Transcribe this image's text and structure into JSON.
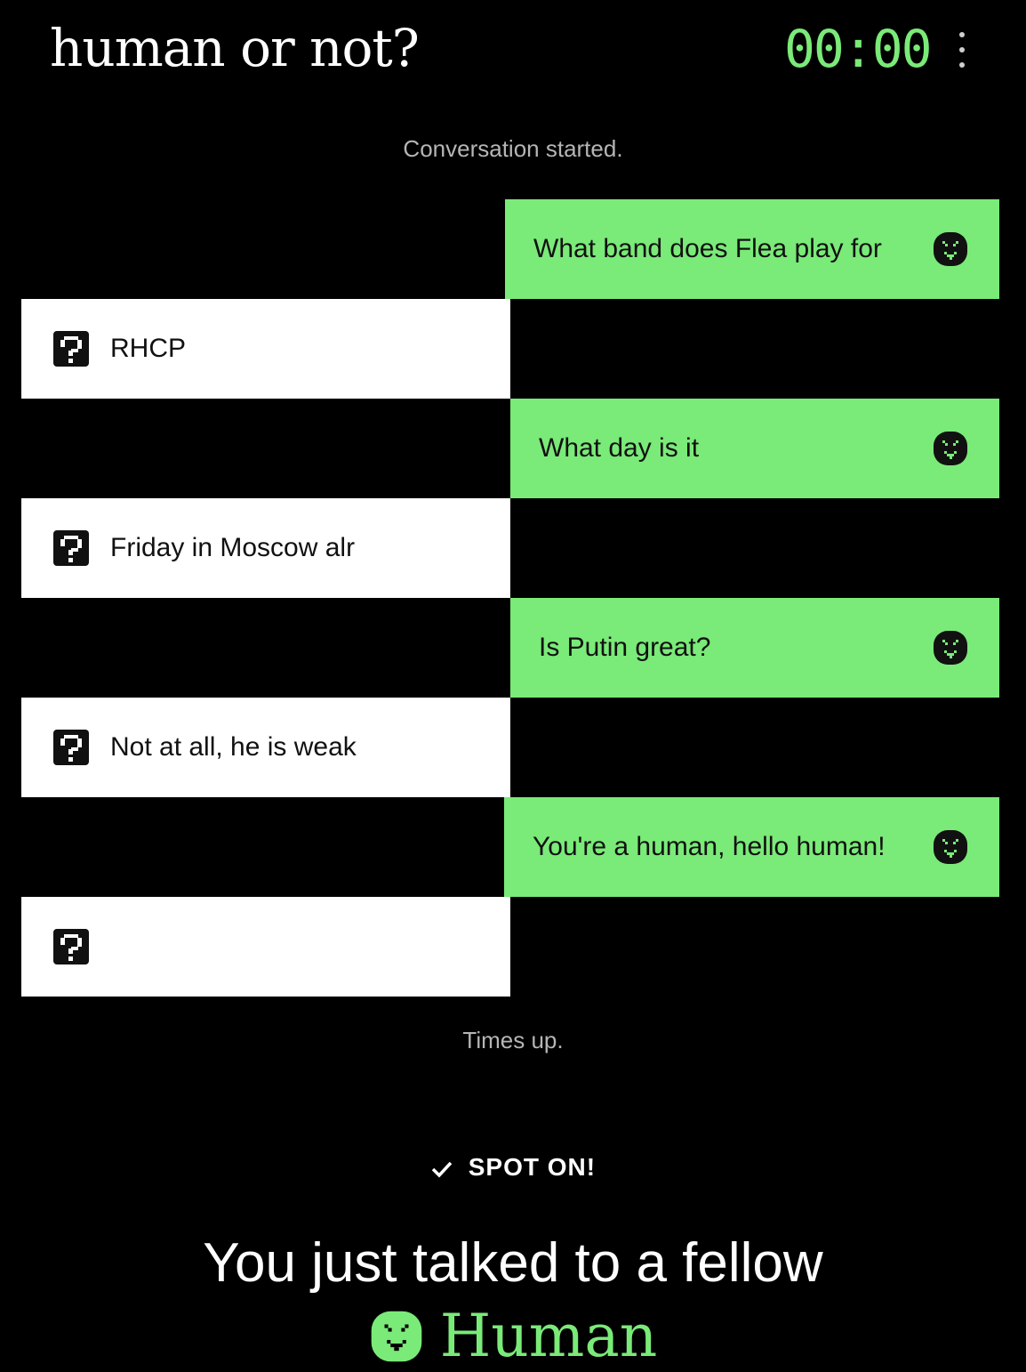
{
  "header": {
    "title": "human or not?",
    "timer": "00:00"
  },
  "conversation": {
    "start_notice": "Conversation started.",
    "end_notice": "Times up.",
    "messages": [
      {
        "from": "me",
        "text": "What band does Flea play for"
      },
      {
        "from": "them",
        "text": "RHCP"
      },
      {
        "from": "me",
        "text": "What day is it"
      },
      {
        "from": "them",
        "text": "Friday in Moscow alr"
      },
      {
        "from": "me",
        "text": "Is Putin great?"
      },
      {
        "from": "them",
        "text": "Not at all, he is weak"
      },
      {
        "from": "me",
        "text": "You're a human, hello human!"
      },
      {
        "from": "them",
        "text": ""
      }
    ]
  },
  "result": {
    "status": "SPOT ON!",
    "headline": "You just talked to a fellow",
    "verdict": "Human"
  },
  "icons": {
    "user_avatar": "smiley-face-icon",
    "partner_avatar": "question-mark-icon",
    "menu": "more-vertical-icon",
    "check": "checkmark-icon"
  },
  "colors": {
    "accent": "#7aea78",
    "background": "#000000",
    "partner_bubble": "#ffffff"
  }
}
